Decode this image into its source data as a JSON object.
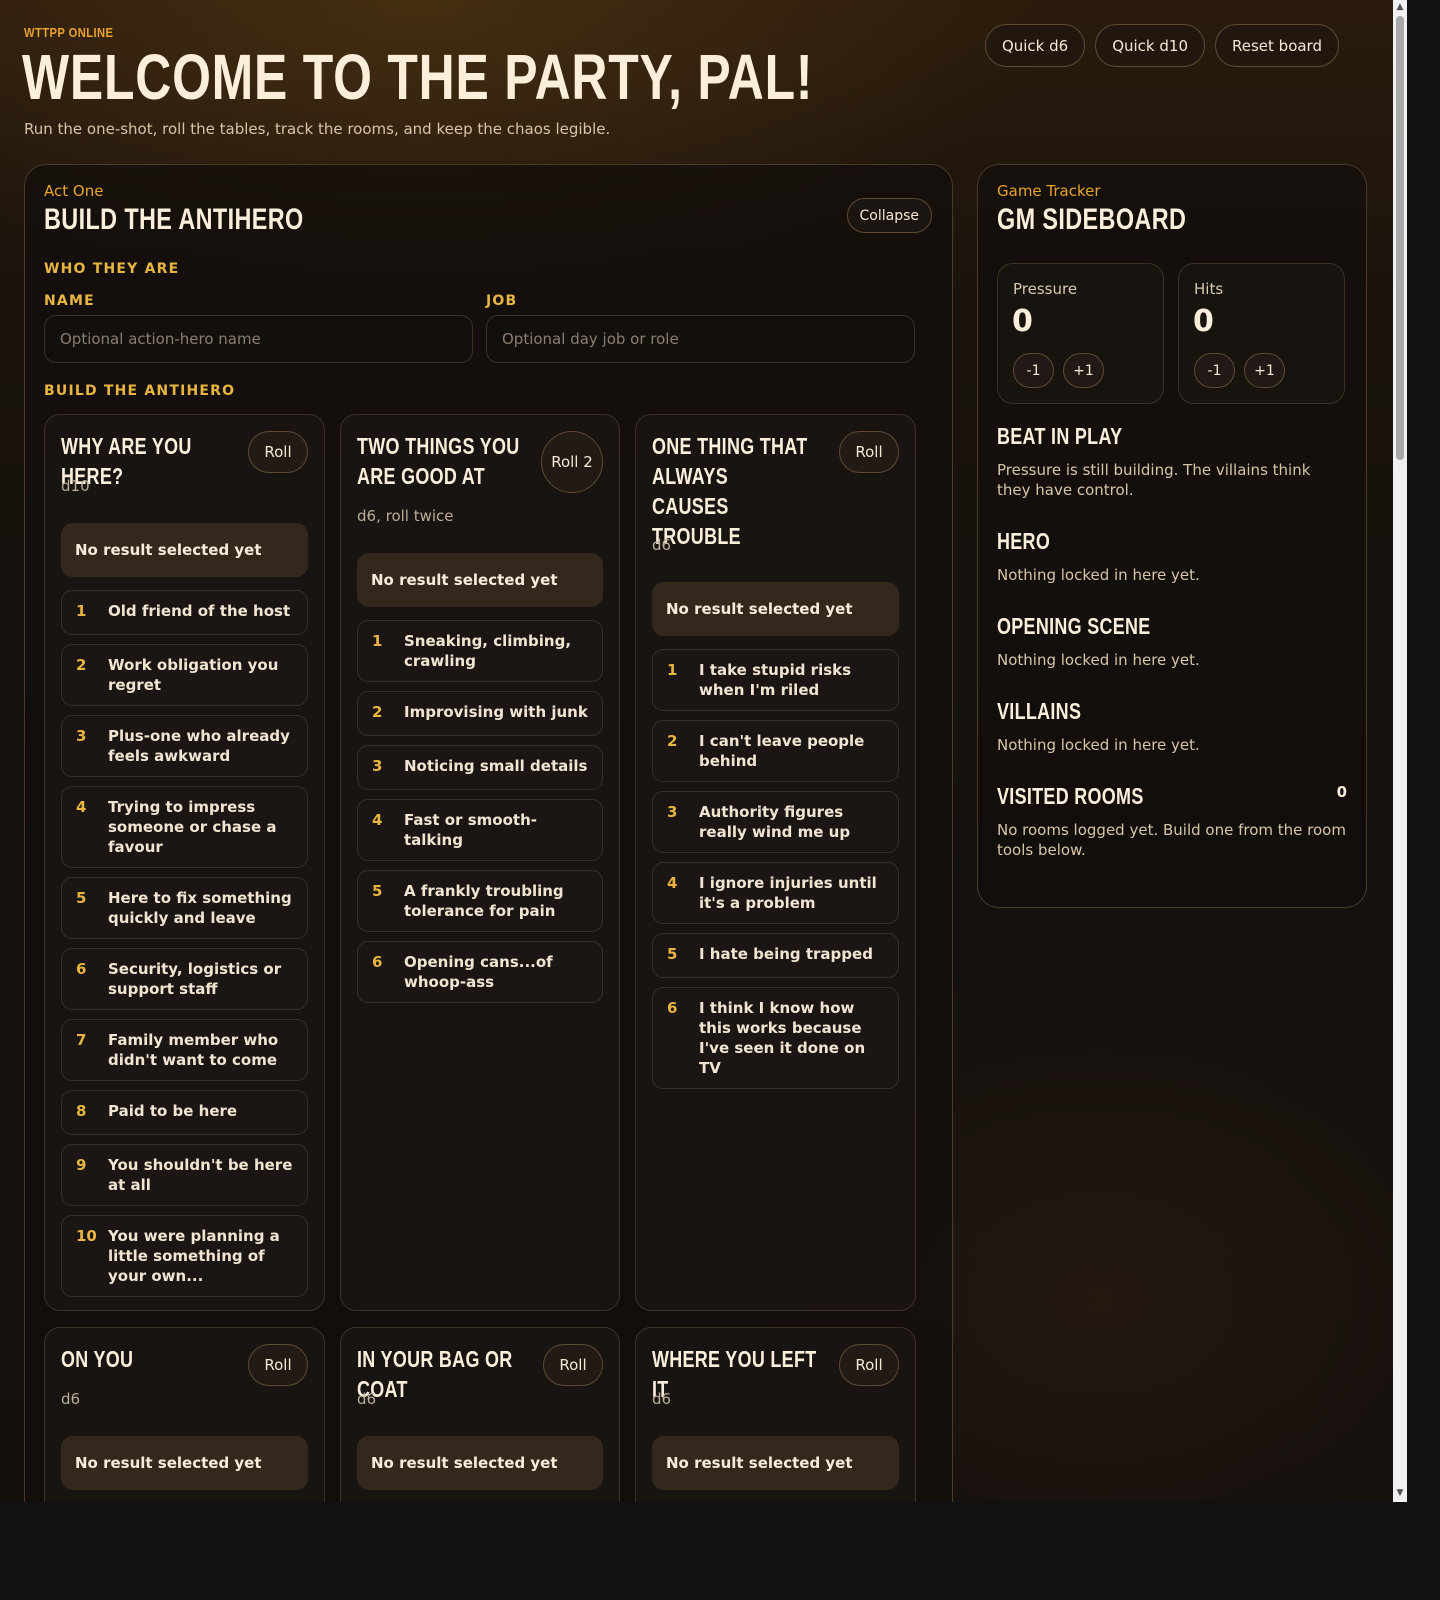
{
  "header": {
    "brand": "WTTPP ONLINE",
    "title": "WELCOME TO THE PARTY, PAL!",
    "tagline": "Run the one-shot, roll the tables, track the rooms, and keep the chaos legible.",
    "actions": [
      "Quick d6",
      "Quick d10",
      "Reset board"
    ]
  },
  "main": {
    "eyebrow": "Act One",
    "title": "BUILD THE ANTIHERO",
    "collapse_label": "Collapse",
    "who_label": "WHO THEY ARE",
    "name_label": "NAME",
    "name_placeholder": "Optional action-hero name",
    "job_label": "JOB",
    "job_placeholder": "Optional day job or role",
    "build_label": "BUILD THE ANTIHERO",
    "cards": [
      {
        "title": "WHY ARE YOU HERE?",
        "roll": "Roll",
        "dice": "d10",
        "result": "No result selected yet",
        "options": [
          "Old friend of the host",
          "Work obligation you regret",
          "Plus-one who already feels awkward",
          "Trying to impress someone or chase a favour",
          "Here to fix something quickly and leave",
          "Security, logistics or support staff",
          "Family member who didn't want to come",
          "Paid to be here",
          "You shouldn't be here at all",
          "You were planning a little something of your own..."
        ]
      },
      {
        "title": "TWO THINGS YOU ARE GOOD AT",
        "roll": "Roll 2",
        "dice": "d6, roll twice",
        "result": "No result selected yet",
        "options": [
          "Sneaking, climbing, crawling",
          "Improvising with junk",
          "Noticing small details",
          "Fast or smooth-talking",
          "A frankly troubling tolerance for pain",
          "Opening cans...of whoop-ass"
        ]
      },
      {
        "title": "ONE THING THAT ALWAYS CAUSES TROUBLE",
        "roll": "Roll",
        "dice": "d6",
        "result": "No result selected yet",
        "options": [
          "I take stupid risks when I'm riled",
          "I can't leave people behind",
          "Authority figures really wind me up",
          "I ignore injuries until it's a problem",
          "I hate being trapped",
          "I think I know how this works because I've seen it done on TV"
        ]
      },
      {
        "title": "ON YOU",
        "roll": "Roll",
        "dice": "d6",
        "result": "No result selected yet"
      },
      {
        "title": "IN YOUR BAG OR COAT",
        "roll": "Roll",
        "dice": "d6",
        "result": "No result selected yet"
      },
      {
        "title": "WHERE YOU LEFT IT",
        "roll": "Roll",
        "dice": "d6",
        "result": "No result selected yet"
      }
    ]
  },
  "sideboard": {
    "eyebrow": "Game Tracker",
    "title": "GM SIDEBOARD",
    "pressure": {
      "label": "Pressure",
      "value": "0",
      "dec": "-1",
      "inc": "+1"
    },
    "hits": {
      "label": "Hits",
      "value": "0",
      "dec": "-1",
      "inc": "+1"
    },
    "beat": {
      "title": "BEAT IN PLAY",
      "body": "Pressure is still building. The villains think they have control."
    },
    "hero": {
      "title": "HERO",
      "body": "Nothing locked in here yet."
    },
    "opening": {
      "title": "OPENING SCENE",
      "body": "Nothing locked in here yet."
    },
    "villains": {
      "title": "VILLAINS",
      "body": "Nothing locked in here yet."
    },
    "rooms": {
      "title": "VISITED ROOMS",
      "count": "0",
      "body": "No rooms logged yet. Build one from the room tools below."
    }
  },
  "colors": {
    "accent": "#e8a32e",
    "gold": "#e7b542",
    "result_bg": "#33281b"
  }
}
